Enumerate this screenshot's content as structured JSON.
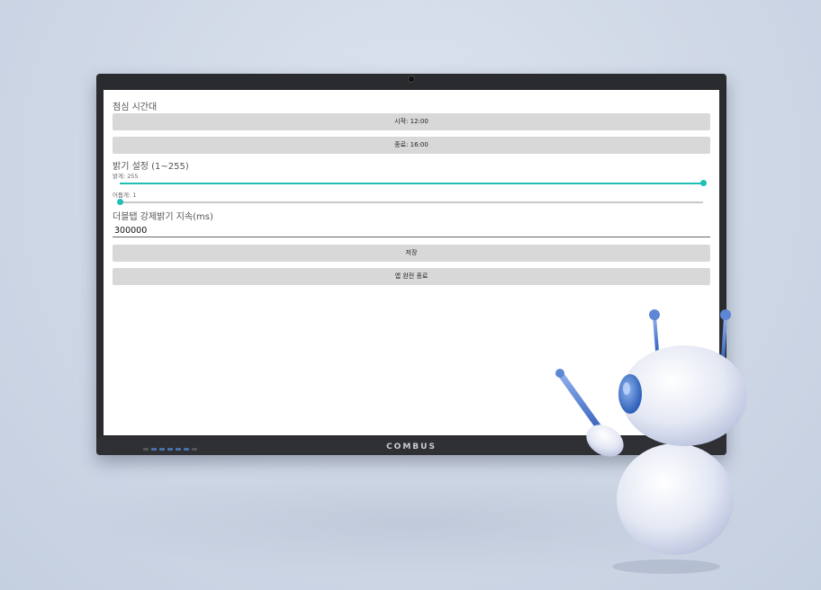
{
  "monitor": {
    "brand": "COMBUS"
  },
  "lunch": {
    "title": "점심 시간대",
    "start_label": "시작: 12:00",
    "end_label": "종료: 16:00"
  },
  "brightness": {
    "title": "밝기 설정 (1~255)",
    "bright_label": "밝게: 255",
    "bright_value": 255,
    "dark_label": "어둡게: 1",
    "dark_value": 1,
    "min": 1,
    "max": 255,
    "accent_color": "#1fbfb6"
  },
  "double_tap": {
    "title": "더블탭 강제밝기 지속(ms)",
    "value": "300000"
  },
  "actions": {
    "save_label": "저장",
    "exit_label": "앱 완전 종료"
  }
}
